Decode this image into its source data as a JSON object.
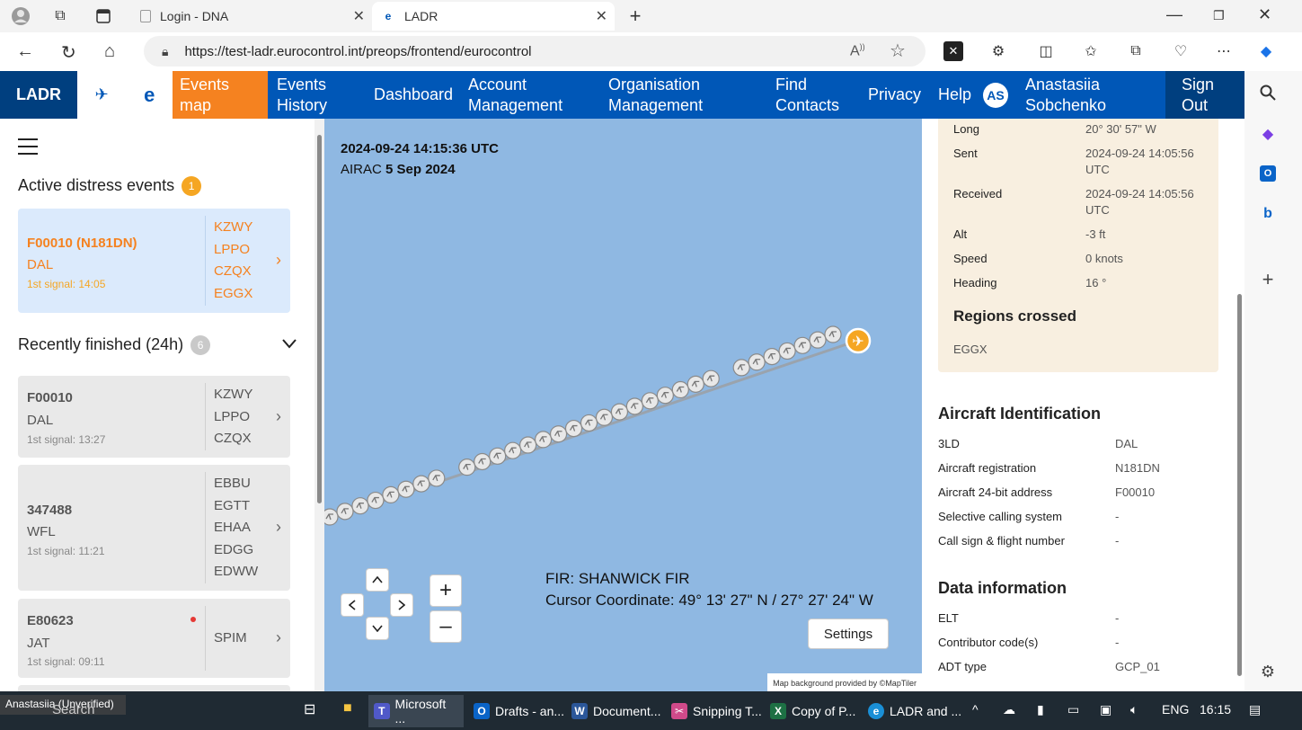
{
  "browser": {
    "tabs": [
      {
        "title": "Login - DNA"
      },
      {
        "title": "LADR"
      }
    ],
    "url": "https://test-ladr.eurocontrol.int/preops/frontend/eurocontrol",
    "new_tab_symbol": "+"
  },
  "header": {
    "logo": "LADR",
    "nav": [
      {
        "label": "Events map"
      },
      {
        "label": "Events History"
      },
      {
        "label": "Dashboard"
      },
      {
        "label": "Account Management"
      },
      {
        "label": "Organisation Management"
      },
      {
        "label": "Find Contacts"
      },
      {
        "label": "Privacy"
      },
      {
        "label": "Help"
      }
    ],
    "user_initials": "AS",
    "user_name": "Anastasiia Sobchenko",
    "sign_out": "Sign Out"
  },
  "left": {
    "active_title": "Active distress events",
    "active_count": "1",
    "active_events": [
      {
        "id": "F00010 (N181DN)",
        "operator": "DAL",
        "signal": "1st signal: 14:05",
        "regions": [
          "KZWY",
          "LPPO",
          "CZQX",
          "EGGX"
        ]
      }
    ],
    "finished_title": "Recently finished (24h)",
    "finished_count": "6",
    "finished_events": [
      {
        "id": "F00010",
        "operator": "DAL",
        "signal": "1st signal: 13:27",
        "regions": [
          "KZWY",
          "LPPO",
          "CZQX"
        ]
      },
      {
        "id": "347488",
        "operator": "WFL",
        "signal": "1st signal: 11:21",
        "regions": [
          "EBBU",
          "EGTT",
          "EHAA",
          "EDGG",
          "EDWW"
        ]
      },
      {
        "id": "E80623",
        "operator": "JAT",
        "signal": "1st signal: 09:11",
        "regions": [
          "SPIM"
        ]
      }
    ]
  },
  "map": {
    "timestamp": "2024-09-24 14:15:36 UTC",
    "airac_label": "AIRAC",
    "airac_value": "5 Sep 2024",
    "fir": "FIR: SHANWICK FIR",
    "cursor": "Cursor Coordinate: 49° 13' 27\" N / 27° 27' 24\" W",
    "settings": "Settings",
    "attribution": "Map background provided by ©MapTiler",
    "zoom_in": "+",
    "zoom_out": "–"
  },
  "right": {
    "position": [
      {
        "label": "Long",
        "value": "20° 30' 57\" W"
      },
      {
        "label": "Sent",
        "value": "2024-09-24 14:05:56 UTC"
      },
      {
        "label": "Received",
        "value": "2024-09-24 14:05:56 UTC"
      },
      {
        "label": "Alt",
        "value": "-3 ft"
      },
      {
        "label": "Speed",
        "value": "0 knots"
      },
      {
        "label": "Heading",
        "value": "16 °"
      }
    ],
    "regions_title": "Regions crossed",
    "regions": "EGGX",
    "aircraft_title": "Aircraft Identification",
    "aircraft": [
      {
        "label": "3LD",
        "value": "DAL"
      },
      {
        "label": "Aircraft registration",
        "value": "N181DN"
      },
      {
        "label": "Aircraft 24-bit address",
        "value": "F00010"
      },
      {
        "label": "Selective calling system",
        "value": "-"
      },
      {
        "label": "Call sign & flight number",
        "value": "-"
      }
    ],
    "data_title": "Data information",
    "data": [
      {
        "label": "ELT",
        "value": "-"
      },
      {
        "label": "Contributor code(s)",
        "value": "-"
      },
      {
        "label": "ADT type",
        "value": "GCP_01"
      }
    ]
  },
  "taskbar": {
    "user_overlay": "Anastasiia (Unverified)",
    "search": "Search",
    "apps": [
      {
        "label": "Microsoft ..."
      },
      {
        "label": "Drafts - an..."
      },
      {
        "label": "Document..."
      },
      {
        "label": "Snipping T..."
      },
      {
        "label": "Copy of P..."
      },
      {
        "label": "LADR and ..."
      }
    ],
    "lang": "ENG",
    "time": "16:15"
  },
  "colors": {
    "header_blue": "#0057b7",
    "active_orange": "#f58220",
    "map_sea": "#8fb8e2",
    "active_card": "#dbeafc",
    "finished_card": "#e9e9e9"
  }
}
